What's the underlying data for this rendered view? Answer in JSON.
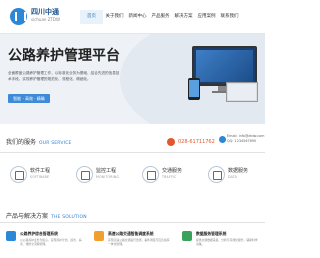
{
  "header": {
    "logo_name": "四川中通",
    "logo_sub": "sichuan ZTDW",
    "nav": [
      {
        "label": "首页",
        "active": true
      },
      {
        "label": "关于我们",
        "active": false
      },
      {
        "label": "新闻中心",
        "active": false
      },
      {
        "label": "产品服务",
        "active": false
      },
      {
        "label": "解决方案",
        "active": false
      },
      {
        "label": "应用案例",
        "active": false
      },
      {
        "label": "联系我们",
        "active": false
      }
    ]
  },
  "banner": {
    "title": "公路养护管理平台",
    "description": "全面覆盖公路养护管理工作，以标准化业务为基础，结合先进的信息技术手段，实现养护管理的规范化、流程化、精细化。",
    "button_label": "智能 · 高效 · 精确"
  },
  "services": {
    "title": "我们的服务",
    "title_en": "OUR SERVICE",
    "phone": "028-61711762",
    "contact_lines": [
      "Email: info@ztdw.com",
      "QQ: 1234567890"
    ],
    "items": [
      {
        "name": "软件工程",
        "en": "SOFTWARE",
        "icon": "software-icon"
      },
      {
        "name": "监控工程",
        "en": "MONITORING",
        "icon": "monitor-icon"
      },
      {
        "name": "交通服务",
        "en": "TRAFFIC",
        "icon": "traffic-icon"
      },
      {
        "name": "数据服务",
        "en": "DATA",
        "icon": "data-icon"
      }
    ]
  },
  "solutions": {
    "title": "产品与解决方案",
    "title_en": "THE SOLUTION",
    "items": [
      {
        "title": "公路养护综合管理系统",
        "desc": "以公路养护业务为核心，实现养护计划、巡查、病害、维修全流程管理。",
        "color": "#2c87d6"
      },
      {
        "title": "高速公路交通智能调度系统",
        "desc": "实现高速公路交通运行监测、事件调度与应急指挥一体化管理。",
        "color": "#f0a030"
      },
      {
        "title": "数据服务管理系统",
        "desc": "提供交通数据采集、分析与可视化服务，辅助科学决策。",
        "color": "#3aa35a"
      }
    ]
  },
  "colors": {
    "accent": "#2c7fd0",
    "phone": "#e4572e",
    "nav_active_bg": "#e9f2fb"
  }
}
